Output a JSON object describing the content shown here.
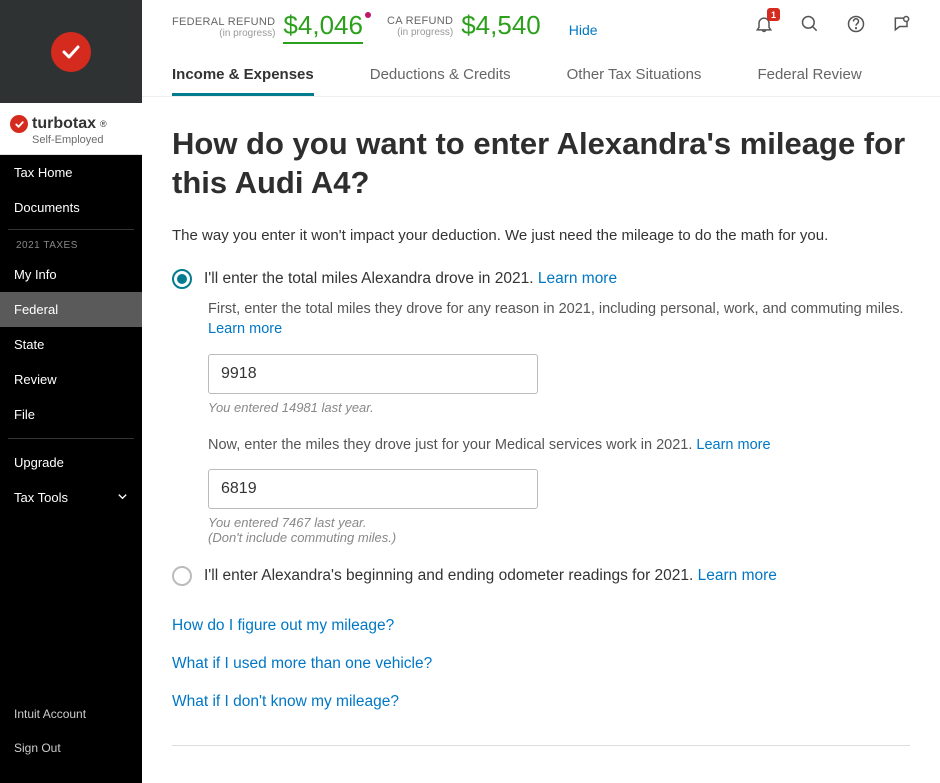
{
  "brand": {
    "name": "turbotax",
    "sub": "Self-Employed"
  },
  "refunds": {
    "federal": {
      "label": "FEDERAL REFUND",
      "progress": "(in progress)",
      "amount": "$4,046"
    },
    "state": {
      "label": "CA REFUND",
      "progress": "(in progress)",
      "amount": "$4,540"
    },
    "hide": "Hide"
  },
  "badge": "1",
  "tabs": {
    "t1": "Income & Expenses",
    "t2": "Deductions & Credits",
    "t3": "Other Tax Situations",
    "t4": "Federal Review"
  },
  "nav": {
    "taxhome": "Tax Home",
    "documents": "Documents",
    "section": "2021 TAXES",
    "myinfo": "My Info",
    "federal": "Federal",
    "state": "State",
    "review": "Review",
    "file": "File",
    "upgrade": "Upgrade",
    "taxtools": "Tax Tools",
    "intuit": "Intuit Account",
    "signout": "Sign Out"
  },
  "page": {
    "title": "How do you want to enter Alexandra's mileage for this Audi A4?",
    "intro": "The way you enter it won't impact your deduction. We just need the mileage to do the math for you.",
    "opt1": "I'll enter the total miles Alexandra drove in 2021. ",
    "learn": "Learn more",
    "help1a": "First, enter the total miles they drove for any reason in 2021, including personal, work, and commuting miles. ",
    "input1": "9918",
    "hint1": "You entered 14981 last year.",
    "help2a": "Now, enter the miles they drove just for your Medical services work in 2021. ",
    "input2": "6819",
    "hint2a": "You entered 7467 last year.",
    "hint2b": "(Don't include commuting miles.)",
    "opt2": "I'll enter Alexandra's beginning and ending odometer readings for 2021. ",
    "faq1": "How do I figure out my mileage?",
    "faq2": "What if I used more than one vehicle?",
    "faq3": "What if I don't know my mileage?"
  }
}
